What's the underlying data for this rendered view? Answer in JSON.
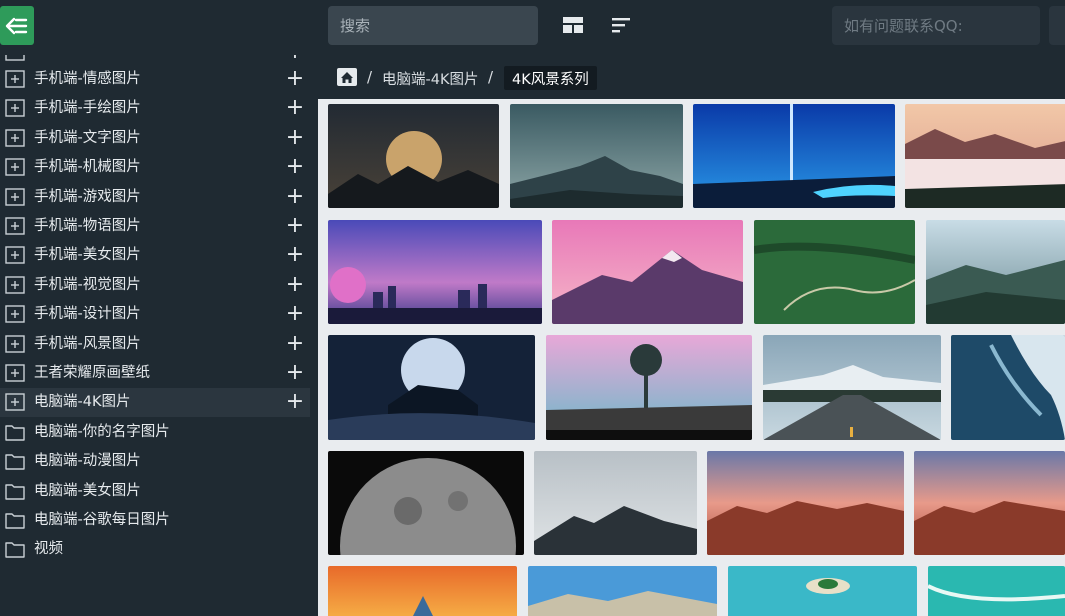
{
  "topbar": {
    "search_placeholder": "搜索",
    "qq_placeholder": "如有问题联系QQ:"
  },
  "sidebar": {
    "items": [
      {
        "label": "手机端-情感图片",
        "type": "expandable"
      },
      {
        "label": "手机端-手绘图片",
        "type": "expandable"
      },
      {
        "label": "手机端-文字图片",
        "type": "expandable"
      },
      {
        "label": "手机端-机械图片",
        "type": "expandable"
      },
      {
        "label": "手机端-游戏图片",
        "type": "expandable"
      },
      {
        "label": "手机端-物语图片",
        "type": "expandable"
      },
      {
        "label": "手机端-美女图片",
        "type": "expandable"
      },
      {
        "label": "手机端-视觉图片",
        "type": "expandable"
      },
      {
        "label": "手机端-设计图片",
        "type": "expandable"
      },
      {
        "label": "手机端-风景图片",
        "type": "expandable"
      },
      {
        "label": "王者荣耀原画壁纸",
        "type": "expandable"
      },
      {
        "label": "电脑端-4K图片",
        "type": "expandable",
        "active": true
      },
      {
        "label": "电脑端-你的名字图片",
        "type": "folder"
      },
      {
        "label": "电脑端-动漫图片",
        "type": "folder"
      },
      {
        "label": "电脑端-美女图片",
        "type": "folder"
      },
      {
        "label": "电脑端-谷歌每日图片",
        "type": "folder"
      },
      {
        "label": "视频",
        "type": "folder"
      }
    ]
  },
  "breadcrumb": {
    "parent": "电脑端-4K图片",
    "separator": "/",
    "current": "4K风景系列"
  },
  "colors": {
    "accent": "#2e9b5a",
    "sidebar_bg": "#1f2a32",
    "gallery_bg": "#e9ecef"
  },
  "gallery": {
    "thumbnails": [
      "moon-over-mountains",
      "misty-mountain-peak",
      "blue-light-beam-lake",
      "sunset-cloud-sea",
      "anime-city-night-sky",
      "pink-snowy-mountain",
      "green-terraced-fields",
      "misty-valley-sunrays",
      "giant-moon-cliff",
      "pink-fantasy-forest",
      "mountain-highway",
      "ocean-waves-aerial",
      "half-moon-closeup",
      "snow-mountain-clouds",
      "red-rock-mountains-sunset",
      "red-rock-mountains-sunset-2",
      "orange-sunset-sky",
      "mountain-range-blue-sky",
      "tropical-island-aerial",
      "turquoise-beach-waves"
    ]
  }
}
